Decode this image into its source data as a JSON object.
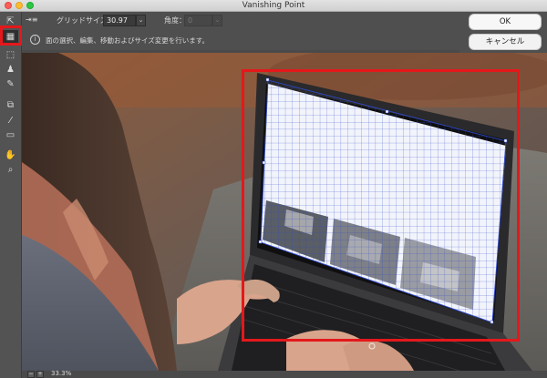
{
  "window": {
    "title": "Vanishing Point"
  },
  "options": {
    "grid_size_label": "グリッドサイズ：",
    "grid_size_value": "30.97",
    "angle_label": "角度：",
    "angle_value": "0"
  },
  "info": {
    "message": "面の選択、編集、移動およびサイズ変更を行います。"
  },
  "buttons": {
    "ok": "OK",
    "cancel": "キャンセル"
  },
  "tools": [
    {
      "name": "edit-plane-tool",
      "icon": "arrow-icon",
      "glyph": "⇱"
    },
    {
      "name": "create-plane-tool",
      "icon": "grid-plane-icon",
      "glyph": "▦",
      "selected": true
    },
    {
      "name": "marquee-tool",
      "icon": "marquee-icon",
      "glyph": "⬚"
    },
    {
      "name": "stamp-tool",
      "icon": "stamp-icon",
      "glyph": "♟"
    },
    {
      "name": "brush-tool",
      "icon": "brush-icon",
      "glyph": "✎"
    },
    {
      "name": "transform-tool",
      "icon": "transform-icon",
      "glyph": "⧉"
    },
    {
      "name": "eyedropper-tool",
      "icon": "eyedropper-icon",
      "glyph": "⁄"
    },
    {
      "name": "measure-tool",
      "icon": "ruler-icon",
      "glyph": "▭"
    },
    {
      "name": "hand-tool",
      "icon": "hand-icon",
      "glyph": "✋"
    },
    {
      "name": "zoom-tool",
      "icon": "zoom-icon",
      "glyph": "⌕"
    }
  ],
  "status": {
    "zoom": "33.3%"
  },
  "colors": {
    "highlight": "#e4181b",
    "grid_line": "#2f48c8"
  }
}
